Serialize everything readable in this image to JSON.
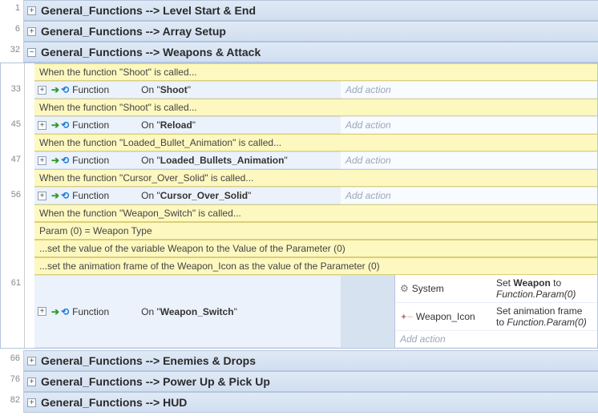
{
  "groups": [
    {
      "line": "1",
      "expanded": false,
      "title": "General_Functions --> Level Start & End"
    },
    {
      "line": "6",
      "expanded": false,
      "title": "General_Functions --> Array Setup"
    }
  ],
  "expandedGroup": {
    "line": "32",
    "title": "General_Functions --> Weapons & Attack"
  },
  "events": [
    {
      "line": "33",
      "comment": "When the function \"Shoot\" is called...",
      "label": "Function",
      "cond": "On \"",
      "bold": "Shoot",
      "addAction": "Add action"
    },
    {
      "line": "45",
      "comment": "When the function \"Shoot\" is called...",
      "label": "Function",
      "cond": "On \"",
      "bold": "Reload",
      "addAction": "Add action"
    },
    {
      "line": "47",
      "comment": "When the function \"Loaded_Bullet_Animation\" is called...",
      "label": "Function",
      "cond": "On \"",
      "bold": "Loaded_Bullets_Animation",
      "addAction": "Add action"
    },
    {
      "line": "56",
      "comment": "When the function \"Cursor_Over_Solid\" is called...",
      "label": "Function",
      "cond": "On \"",
      "bold": "Cursor_Over_Solid",
      "addAction": "Add action"
    }
  ],
  "switchEvent": {
    "line": "61",
    "comments": [
      "When the function \"Weapon_Switch\" is called...",
      "Param (0) = Weapon Type",
      "...set the value of the variable Weapon to the Value of the Parameter (0)",
      "...set the animation frame of the Weapon_Icon as the value of the Parameter (0)"
    ],
    "label": "Function",
    "cond": "On \"",
    "bold": "Weapon_Switch",
    "actions": [
      {
        "icon": "gear",
        "obj": "System",
        "pre": "Set ",
        "b1": "Weapon",
        "mid": " to ",
        "i1": "Function.Param(0)"
      },
      {
        "icon": "wand",
        "obj": "Weapon_Icon",
        "pre": "Set animation frame to ",
        "i1": "Function.Param(0)"
      }
    ],
    "addAction": "Add action"
  },
  "groupsAfter": [
    {
      "line": "66",
      "title": "General_Functions --> Enemies & Drops"
    },
    {
      "line": "76",
      "title": "General_Functions --> Power Up & Pick Up"
    },
    {
      "line": "82",
      "title": "General_Functions --> HUD"
    }
  ]
}
